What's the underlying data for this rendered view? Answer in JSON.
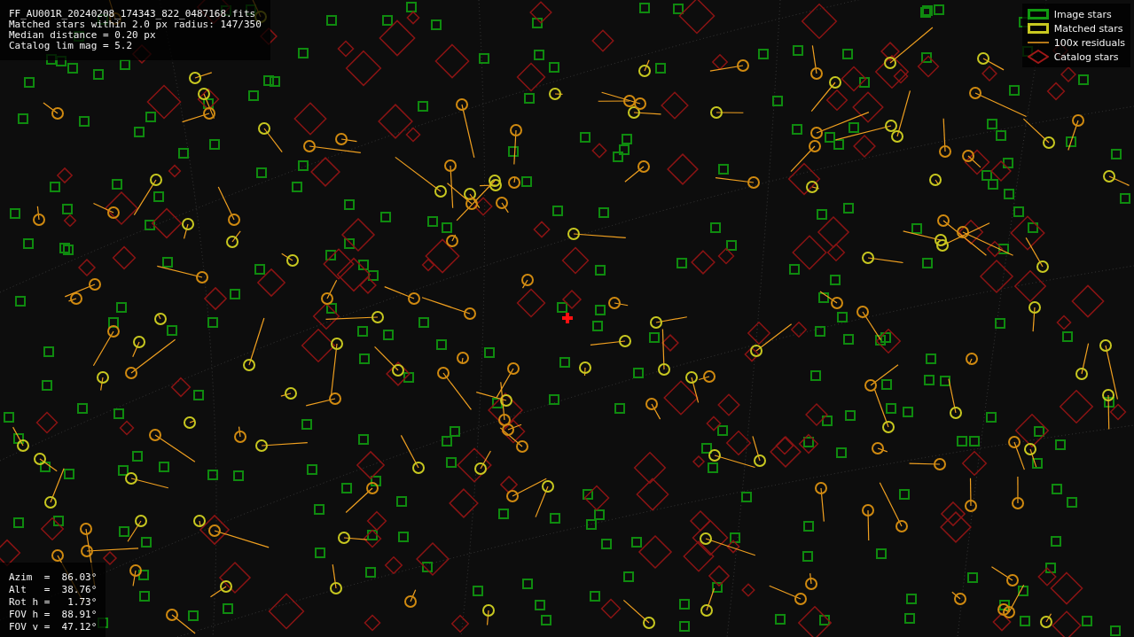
{
  "header_info": [
    "FF_AU001R_20240208_174343_822_0487168.fits",
    "Matched stars within 2.0 px radius: 147/350",
    "Median distance = 0.20 px",
    "Catalog lim mag = 5.2"
  ],
  "legend": [
    {
      "kind": "image",
      "label": "Image stars"
    },
    {
      "kind": "matched",
      "label": "Matched stars"
    },
    {
      "kind": "residual",
      "label": "100x residuals"
    },
    {
      "kind": "catalog",
      "label": "Catalog stars"
    }
  ],
  "pointing": [
    "Azim  =  86.03°",
    "Alt   =  38.76°",
    "Rot h =   1.73°",
    "FOV h =  88.91°",
    "FOV v =  47.12°"
  ]
}
